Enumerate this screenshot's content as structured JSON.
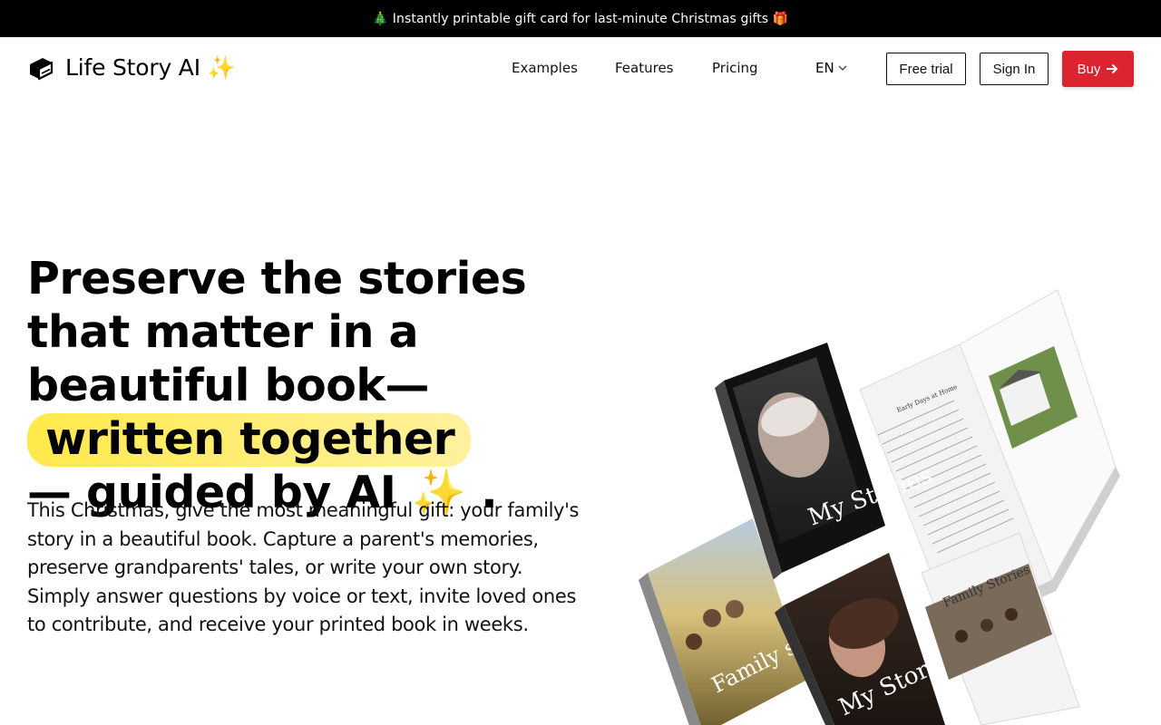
{
  "announcement": {
    "tree_emoji": "🎄",
    "text": "Instantly printable gift card for last-minute Christmas gifts",
    "gift_emoji": "🎁"
  },
  "nav": {
    "brand": "Life Story AI",
    "brand_emoji": "✨",
    "links": [
      "Examples",
      "Features",
      "Pricing"
    ],
    "language": "EN",
    "free_trial": "Free trial",
    "sign_in": "Sign In",
    "buy": "Buy"
  },
  "hero": {
    "title_part1": "Preserve the stories that matter in a beautiful book—",
    "title_highlight": "written together",
    "title_part2": "— guided by AI",
    "title_emoji": "✨",
    "title_end": ".",
    "description": "This Christmas, give the most meaningful gift: your family's story in a beautiful book. Capture a parent's memories, preserve grandparents' tales, or write your own story. Simply answer questions by voice or text, invite loved ones to contribute, and receive your printed book in weeks."
  },
  "books": {
    "cover1_title": "My Stories",
    "cover2_title": "Family stories",
    "cover3_title": "My Story",
    "cover4_title": "Family Stories",
    "spread_heading": "Early Days at Home"
  },
  "colors": {
    "accent": "#dc2431",
    "highlight": "#ffe94a",
    "banner": "#000000"
  }
}
